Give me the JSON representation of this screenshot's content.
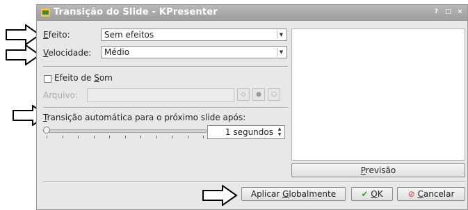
{
  "window": {
    "title": "Transição do Slide - KPresenter",
    "titlebar_buttons": [
      "?",
      "□",
      "×"
    ]
  },
  "form": {
    "effect_label_prefix": "",
    "effect_label_accel": "E",
    "effect_label_rest": "feito:",
    "effect_value": "Sem efeitos",
    "speed_label_accel": "V",
    "speed_label_rest": "elocidade:",
    "speed_value": "Médio",
    "sound_label_prefix": "Efeito de ",
    "sound_label_accel": "S",
    "sound_label_rest": "om",
    "file_label": "Arquivo:",
    "auto_label_accel": "T",
    "auto_label_rest": "ransição automática para o próximo slide após:",
    "seconds_value": "1 segundos",
    "slider_value": 1
  },
  "buttons": {
    "preview_accel": "P",
    "preview_rest": "revisão",
    "apply_global_prefix": "Aplicar ",
    "apply_global_accel": "G",
    "apply_global_rest": "lobalmente",
    "ok_accel": "O",
    "ok_rest": "K",
    "cancel_accel": "C",
    "cancel_rest": "ancelar"
  },
  "icons": {
    "app": "kpresenter-icon",
    "ok": "check-icon",
    "cancel": "cancel-icon",
    "play": "play-icon",
    "arrow": "right-arrow-callout"
  },
  "colors": {
    "titlebar": "#a8a8a8",
    "ok_check": "#3aa63a",
    "cancel_icon": "#c04040"
  }
}
